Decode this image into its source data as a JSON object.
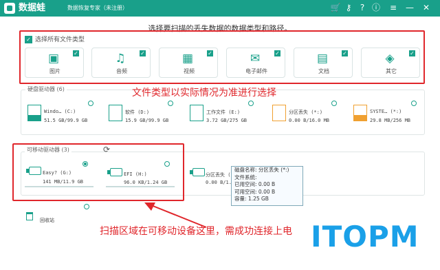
{
  "app": {
    "name": "数据蛙",
    "subtitle": "数据恢复专家（未注册）",
    "toolbar_icons": [
      "cart-icon",
      "key-icon",
      "help-icon",
      "info-icon",
      "menu-icon",
      "minimize-icon",
      "close-icon"
    ],
    "toolbar_glyphs": [
      "🛒",
      "⚷",
      "?",
      "ⓘ",
      "≡",
      "—",
      "✕"
    ]
  },
  "heading": "选择要扫描的丢失数据的数据类型和路径。",
  "file_types": {
    "select_all_label": "选择所有文件类型",
    "items": [
      {
        "label": "图片",
        "icon": "image-icon",
        "glyph": "▣",
        "checked": true
      },
      {
        "label": "音频",
        "icon": "audio-icon",
        "glyph": "♫",
        "checked": true
      },
      {
        "label": "视频",
        "icon": "video-icon",
        "glyph": "▦",
        "checked": true
      },
      {
        "label": "电子邮件",
        "icon": "email-icon",
        "glyph": "✉",
        "checked": true
      },
      {
        "label": "文档",
        "icon": "document-icon",
        "glyph": "▤",
        "checked": true
      },
      {
        "label": "其它",
        "icon": "other-icon",
        "glyph": "◈",
        "checked": true
      }
    ]
  },
  "annotations": {
    "file_types": "文件类型以实际情况为准进行选择",
    "scan_area": "扫描区域在可移动设备这里，需成功连接上电"
  },
  "hard_drives": {
    "title": "硬盘驱动器 (6)",
    "drives": [
      {
        "name": "Windo… (C:)",
        "size": "51.5 GB/99.9 GB",
        "usage": 0.52,
        "color": "#19a08a"
      },
      {
        "name": "软件 (D:)",
        "size": "15.9 GB/99.9 GB",
        "usage": 0.16,
        "color": "#19a08a"
      },
      {
        "name": "工作文件 (E:)",
        "size": "3.72 GB/275 GB",
        "usage": 0.01,
        "color": "#19a08a"
      },
      {
        "name": "分区丢失 (*:)",
        "size": "0.00  B/16.0 MB",
        "usage": 0.0,
        "color": "#f0a030"
      },
      {
        "name": "SYSTE… (*:)",
        "size": "29.8 MB/256 MB",
        "usage": 0.12,
        "color": "#f0a030"
      }
    ]
  },
  "removable_drives": {
    "title": "可移动驱动器 (3)",
    "drives": [
      {
        "name": "Easy? (G:)",
        "size": "141 MB/11.9 GB",
        "selected": true
      },
      {
        "name": "EFI (H:)",
        "size": "96.0 KB/1.24 GB",
        "selected": false
      },
      {
        "name": "分区丢失 (*:)",
        "size": "0.00  B/1.25 G",
        "selected": false
      }
    ]
  },
  "tooltip": {
    "lines": [
      "磁盘名称:  分区丢失 (*:)",
      "文件系统:",
      "已用空间:  0.00  B",
      "可用空间:  0.00  B",
      "容量:  1.25 GB"
    ]
  },
  "recycle_bin": {
    "label": "回收站"
  },
  "watermark": "ITOPM"
}
